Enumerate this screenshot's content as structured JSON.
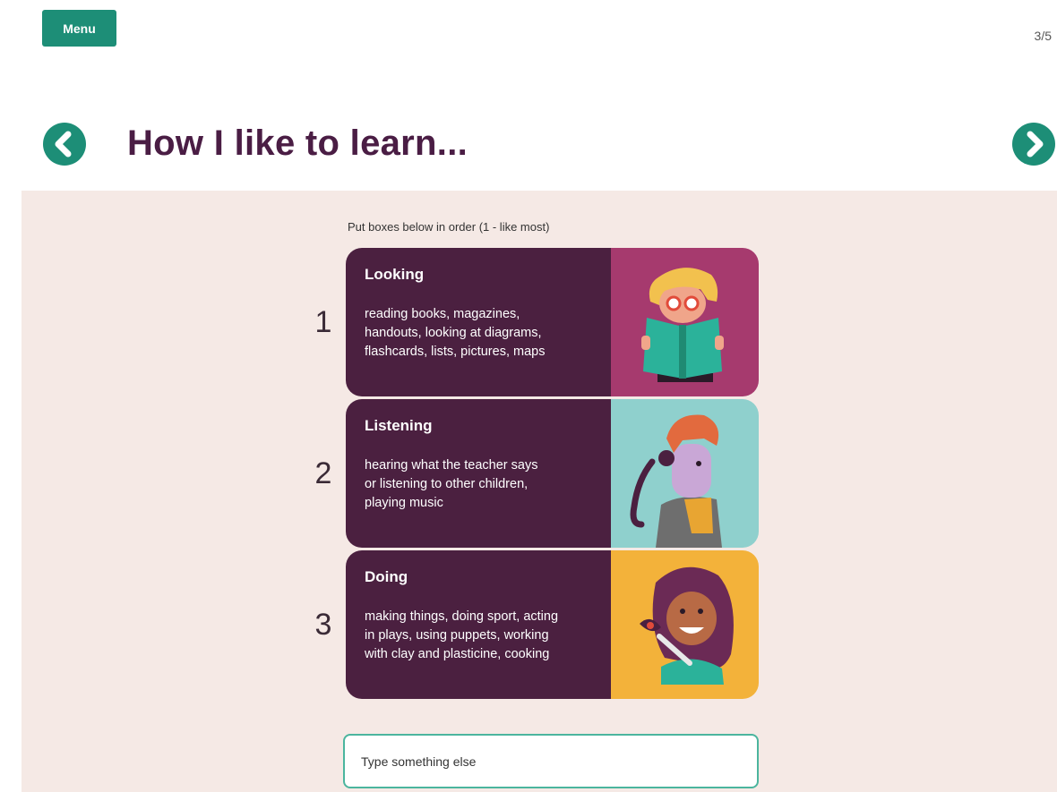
{
  "header": {
    "menu_label": "Menu",
    "page_indicator": "3/5",
    "title": "How I like to learn..."
  },
  "main": {
    "instruction": "Put boxes below in order (1 - like most)",
    "cards": [
      {
        "rank": "1",
        "title": "Looking",
        "description": "reading books, magazines,\nhandouts, looking at diagrams,\nflashcards,  lists, pictures, maps",
        "image_bg": "#a63a6e",
        "icon": "girl-reading-book-icon"
      },
      {
        "rank": "2",
        "title": "Listening",
        "description": "hearing what the teacher says\nor listening to other children,\nplaying music",
        "image_bg": "#8fd0cd",
        "icon": "boy-listening-icon"
      },
      {
        "rank": "3",
        "title": "Doing",
        "description": "making things, doing sport, acting\nin plays, using puppets, working\nwith clay and plasticine, cooking",
        "image_bg": "#f3b23a",
        "icon": "girl-painting-icon"
      }
    ],
    "other_input": {
      "placeholder": "Type something else"
    }
  },
  "colors": {
    "accent": "#1d8e77",
    "title": "#4a1d44",
    "card_bg": "#4b2040",
    "content_bg": "#f5e9e5"
  }
}
